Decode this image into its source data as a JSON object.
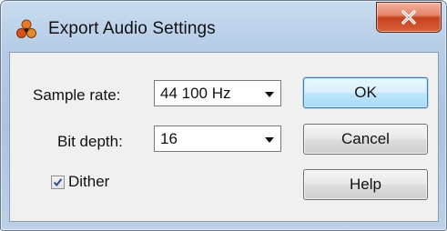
{
  "window": {
    "title": "Export Audio Settings",
    "app_icon": "app-logo-icon",
    "close_icon": "close-icon"
  },
  "sample_rate": {
    "label": "Sample rate:",
    "value": "44 100 Hz"
  },
  "bit_depth": {
    "label": "Bit depth:",
    "value": "16"
  },
  "dither": {
    "label": "Dither",
    "checked": true
  },
  "buttons": {
    "ok": "OK",
    "cancel": "Cancel",
    "help": "Help"
  },
  "colors": {
    "titlebar": "#b6cde6",
    "close_button": "#c8421f",
    "default_button": "#bee6fd"
  }
}
